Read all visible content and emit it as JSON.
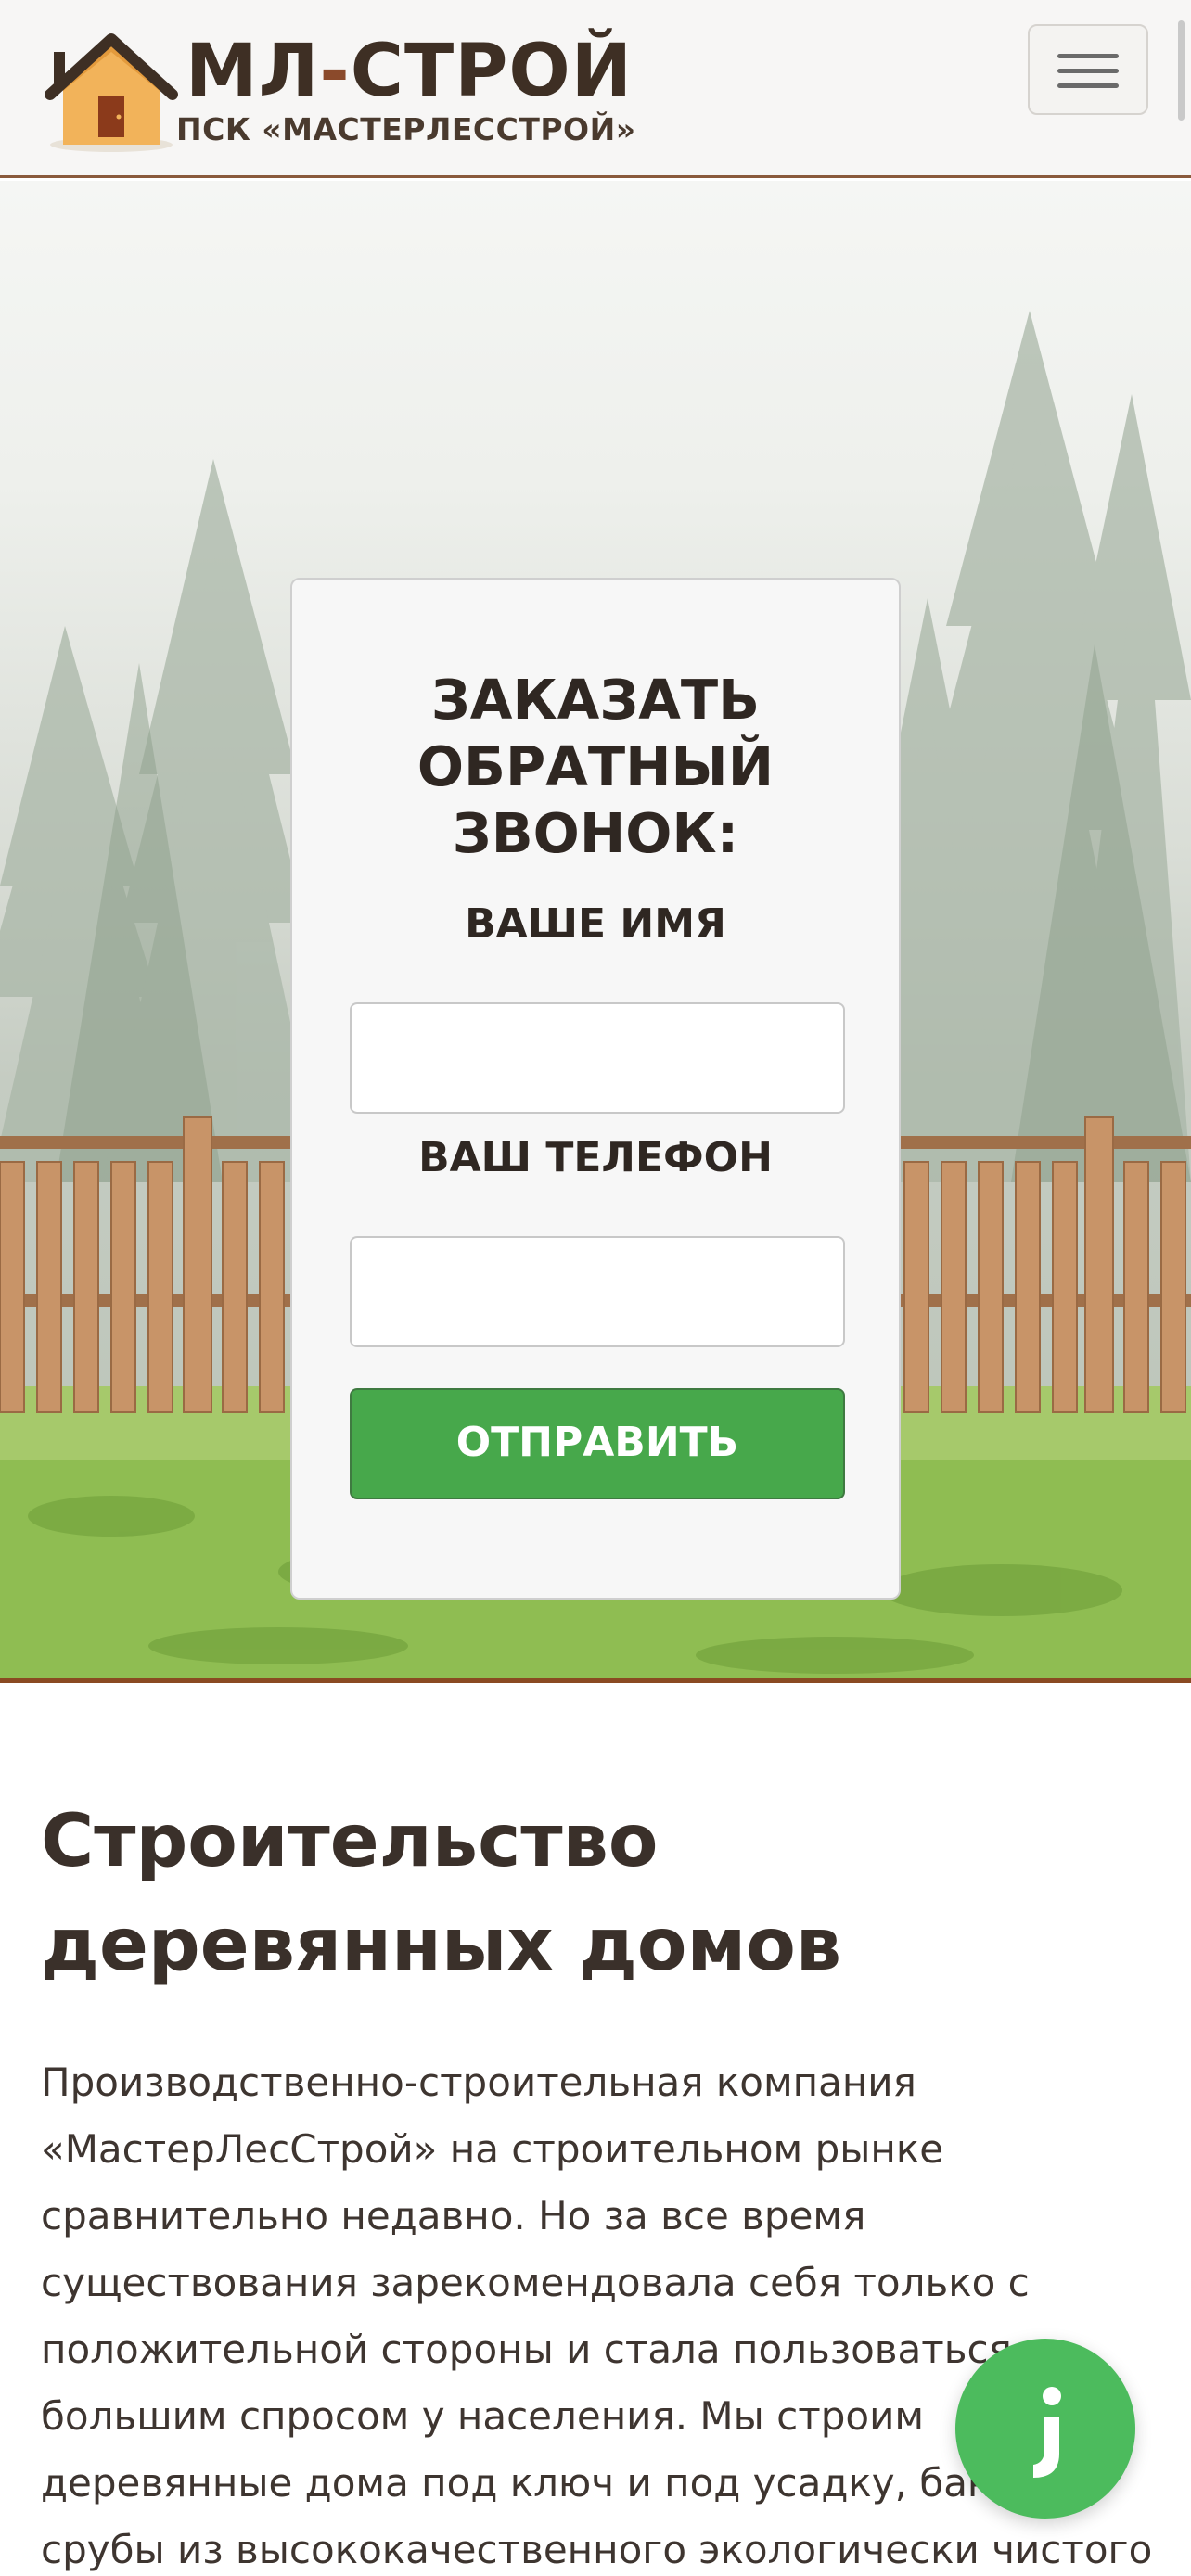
{
  "header": {
    "logo_title_main": "МЛ",
    "logo_title_dash": "-",
    "logo_title_rest": "СТРОЙ",
    "logo_subtitle": "ПСК «МАСТЕРЛЕССТРОЙ»",
    "menu_icon": "hamburger-menu-icon"
  },
  "callback_form": {
    "title": "ЗАКАЗАТЬ ОБРАТНЫЙ ЗВОНОК:",
    "name_label": "ВАШЕ ИМЯ",
    "name_value": "",
    "phone_label": "ВАШ ТЕЛЕФОН",
    "phone_value": "",
    "submit_label": "ОТПРАВИТЬ"
  },
  "content": {
    "title": "Строительство деревянных домов",
    "paragraph": "Производственно-строительная компания «МастерЛесСтрой» на строительном рынке сравнительно недавно. Но за все время существования зарекомендовала себя только с положительной стороны и стала пользоваться большим спросом у населения. Мы строим деревянные дома под ключ и под усадку, бани, срубы из высококачественного экологически чистого"
  },
  "chat": {
    "icon": "chat-widget-icon"
  },
  "colors": {
    "brand_brown": "#8b4a2b",
    "dark_text": "#3e2f24",
    "submit_green": "#47a84b",
    "chat_green": "#4cbb5d"
  }
}
